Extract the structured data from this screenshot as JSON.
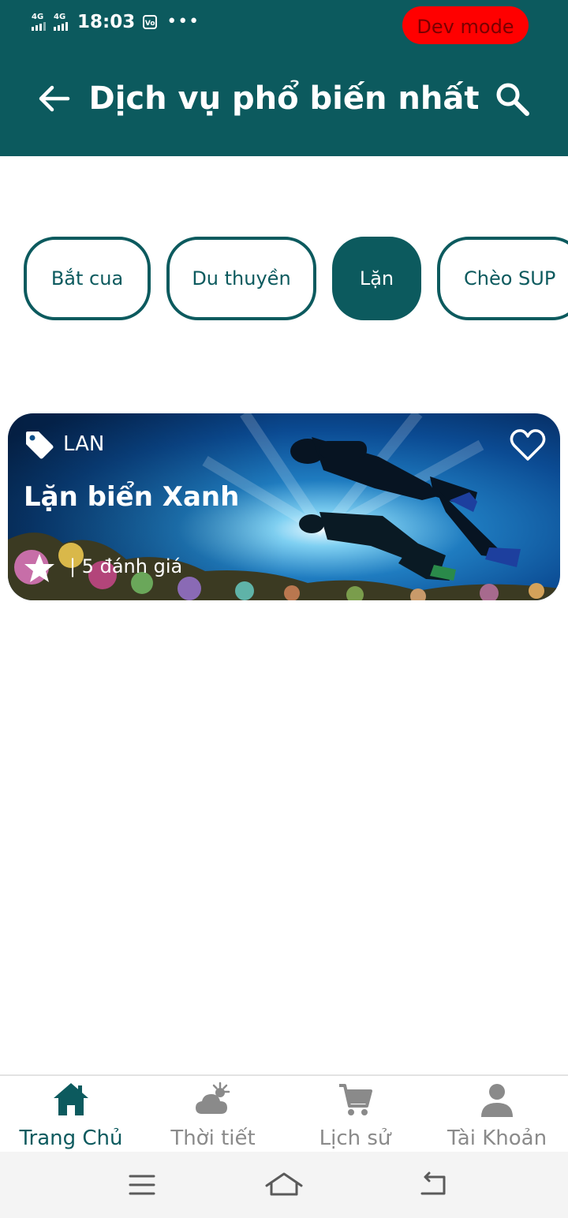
{
  "status_bar": {
    "signal_1": "4G",
    "signal_2": "4G",
    "time": "18:03",
    "vo_badge": "Vo",
    "more": "•••",
    "dev_badge": "Dev mode"
  },
  "header": {
    "title": "Dịch vụ phổ biến nhất",
    "back_icon": "arrow-left-icon",
    "search_icon": "search-icon"
  },
  "categories": [
    {
      "label": "Bắt cua",
      "active": false
    },
    {
      "label": "Du thuyền",
      "active": false
    },
    {
      "label": "Lặn",
      "active": true
    },
    {
      "label": "Chèo SUP",
      "active": false
    }
  ],
  "service_card": {
    "tag": "LAN",
    "title": "Lặn biển Xanh",
    "rating_text": "| 5 đánh giá",
    "favorite_icon": "heart-outline-icon"
  },
  "bottom_nav": [
    {
      "label": "Trang Chủ",
      "icon": "home-icon",
      "active": true
    },
    {
      "label": "Thời tiết",
      "icon": "weather-icon",
      "active": false
    },
    {
      "label": "Lịch sử",
      "icon": "cart-icon",
      "active": false
    },
    {
      "label": "Tài Khoản",
      "icon": "account-icon",
      "active": false
    }
  ],
  "colors": {
    "primary": "#0c5a5e",
    "dev_badge": "#ff0000",
    "inactive_nav": "#8a8a8a"
  }
}
